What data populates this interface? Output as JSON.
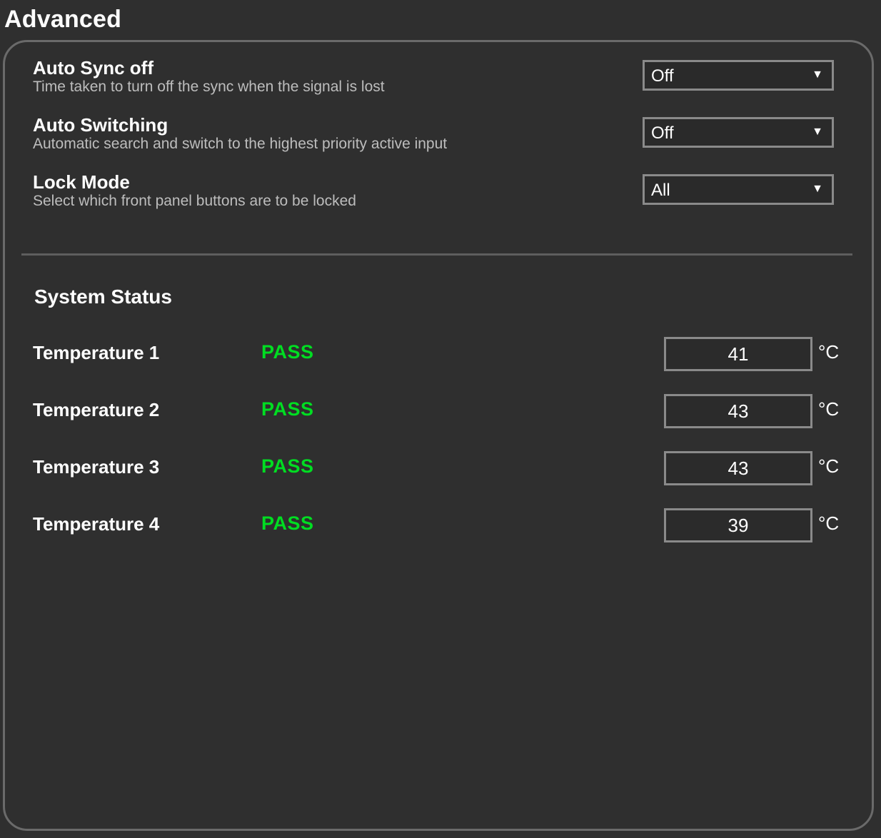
{
  "page": {
    "title": "Advanced"
  },
  "settings": [
    {
      "title": "Auto Sync off",
      "description": "Time taken to turn off the sync when the signal is lost",
      "selected": "Off"
    },
    {
      "title": "Auto Switching",
      "description": "Automatic search and switch to the highest priority active input",
      "selected": "Off"
    },
    {
      "title": "Lock Mode",
      "description": "Select which front panel buttons are to be locked",
      "selected": "All"
    }
  ],
  "dropdown_icon": "caret-down",
  "system_status": {
    "title": "System Status",
    "unit": "°C",
    "pass_color": "#00dd22",
    "items": [
      {
        "label": "Temperature 1",
        "status": "PASS",
        "value": "41"
      },
      {
        "label": "Temperature 2",
        "status": "PASS",
        "value": "43"
      },
      {
        "label": "Temperature 3",
        "status": "PASS",
        "value": "43"
      },
      {
        "label": "Temperature 4",
        "status": "PASS",
        "value": "39"
      }
    ]
  }
}
